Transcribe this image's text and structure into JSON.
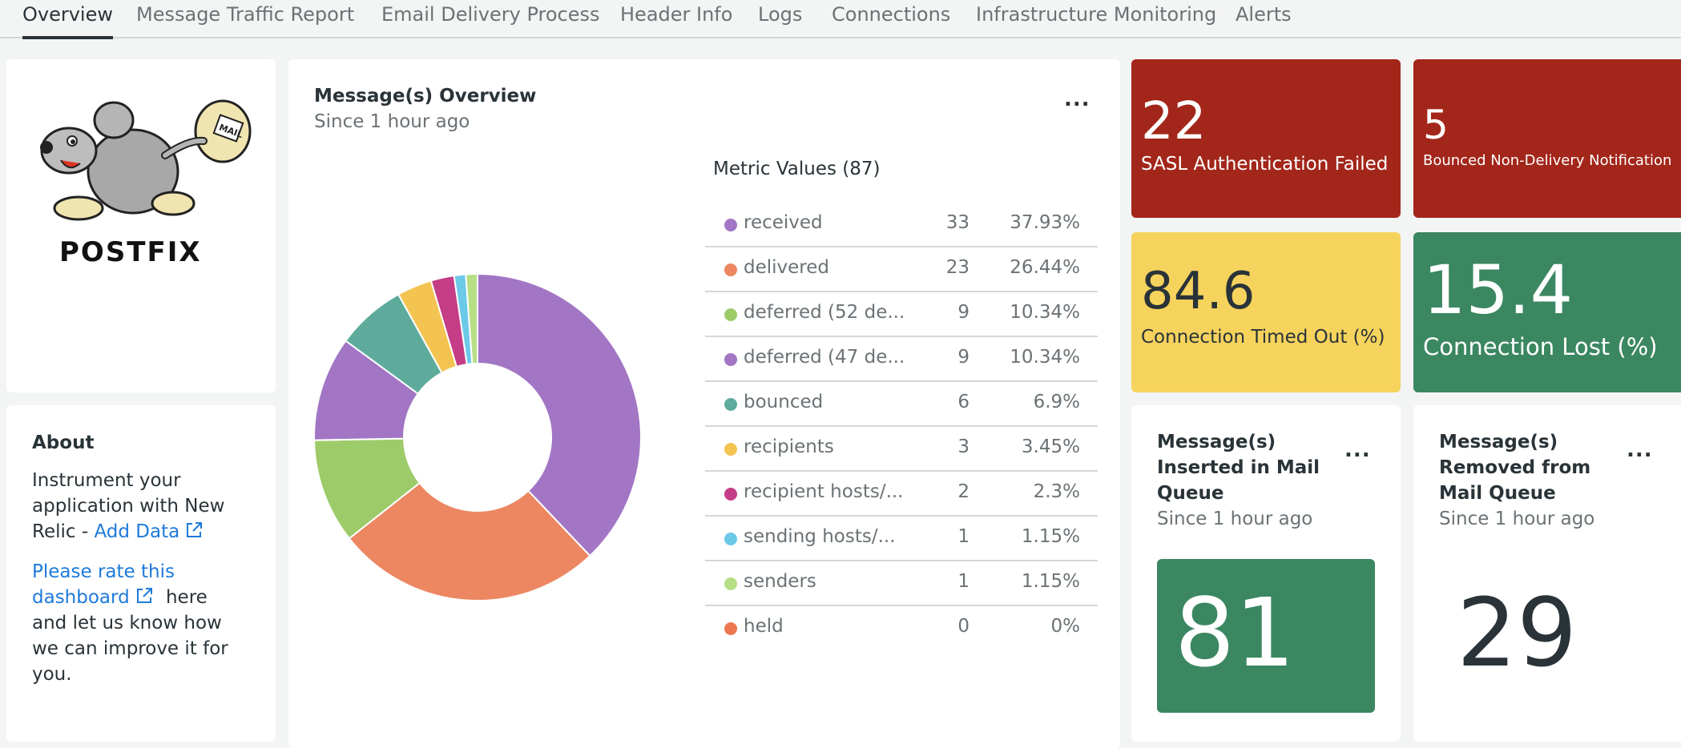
{
  "tabs": [
    {
      "label": "Overview"
    },
    {
      "label": "Message Traffic Report"
    },
    {
      "label": "Email Delivery Process"
    },
    {
      "label": "Header Info"
    },
    {
      "label": "Logs"
    },
    {
      "label": "Connections"
    },
    {
      "label": "Infrastructure Monitoring"
    },
    {
      "label": "Alerts"
    }
  ],
  "logo": {
    "text": "POSTFIX",
    "bag_text": "MAIL"
  },
  "about": {
    "title": "About",
    "line1": "Instrument your",
    "line2": "application with New",
    "line3_prefix": "Relic - ",
    "add_data_link": "Add Data",
    "rate_link_line1": "Please rate this",
    "rate_link_line2": "dashboard",
    "rate_suffix": "here",
    "line_a": "and let us know how",
    "line_b": "we can improve it for",
    "line_c": "you."
  },
  "overview": {
    "title": "Message(s) Overview",
    "subtitle": "Since 1 hour ago",
    "metric_title": "Metric Values (87)",
    "more": "..."
  },
  "chart_data": {
    "type": "pie",
    "donut": true,
    "total": 87,
    "slices": [
      {
        "label": "received",
        "value": 33,
        "percent": "37.93%",
        "color": "#a276c4"
      },
      {
        "label": "delivered",
        "value": 23,
        "percent": "26.44%",
        "color": "#ec8762"
      },
      {
        "label": "deferred (52 de...",
        "value": 9,
        "percent": "10.34%",
        "color": "#9ecb6a"
      },
      {
        "label": "deferred (47 de...",
        "value": 9,
        "percent": "10.34%",
        "color": "#a276c4"
      },
      {
        "label": "bounced",
        "value": 6,
        "percent": "6.9%",
        "color": "#5eab9c"
      },
      {
        "label": "recipients",
        "value": 3,
        "percent": "3.45%",
        "color": "#f4c452"
      },
      {
        "label": "recipient hosts/...",
        "value": 2,
        "percent": "2.3%",
        "color": "#c43d86"
      },
      {
        "label": "sending hosts/...",
        "value": 1,
        "percent": "1.15%",
        "color": "#6cc9e8"
      },
      {
        "label": "senders",
        "value": 1,
        "percent": "1.15%",
        "color": "#b6df86"
      },
      {
        "label": "held",
        "value": 0,
        "percent": "0%",
        "color": "#ec7750"
      }
    ]
  },
  "billboards": {
    "sasl": {
      "value": "22",
      "label": "SASL Authentication Failed",
      "color": "#a3261a"
    },
    "bounced": {
      "value": "5",
      "label": "Bounced Non-Delivery Notification",
      "color": "#a3261a"
    },
    "timed_out": {
      "value": "84.6",
      "label": "Connection Timed Out (%)",
      "color": "#f6d35d"
    },
    "lost": {
      "value": "15.4",
      "label": "Connection Lost (%)",
      "color": "#3b8761"
    }
  },
  "inserted": {
    "title_l1": "Message(s)",
    "title_l2": "Inserted in Mail",
    "title_l3": "Queue",
    "subtitle": "Since 1 hour ago",
    "value": "81",
    "color": "#3b8761",
    "more": "..."
  },
  "removed": {
    "title_l1": "Message(s)",
    "title_l2": "Removed from",
    "title_l3": "Mail Queue",
    "subtitle": "Since 1 hour ago",
    "value": "29",
    "more": "..."
  }
}
